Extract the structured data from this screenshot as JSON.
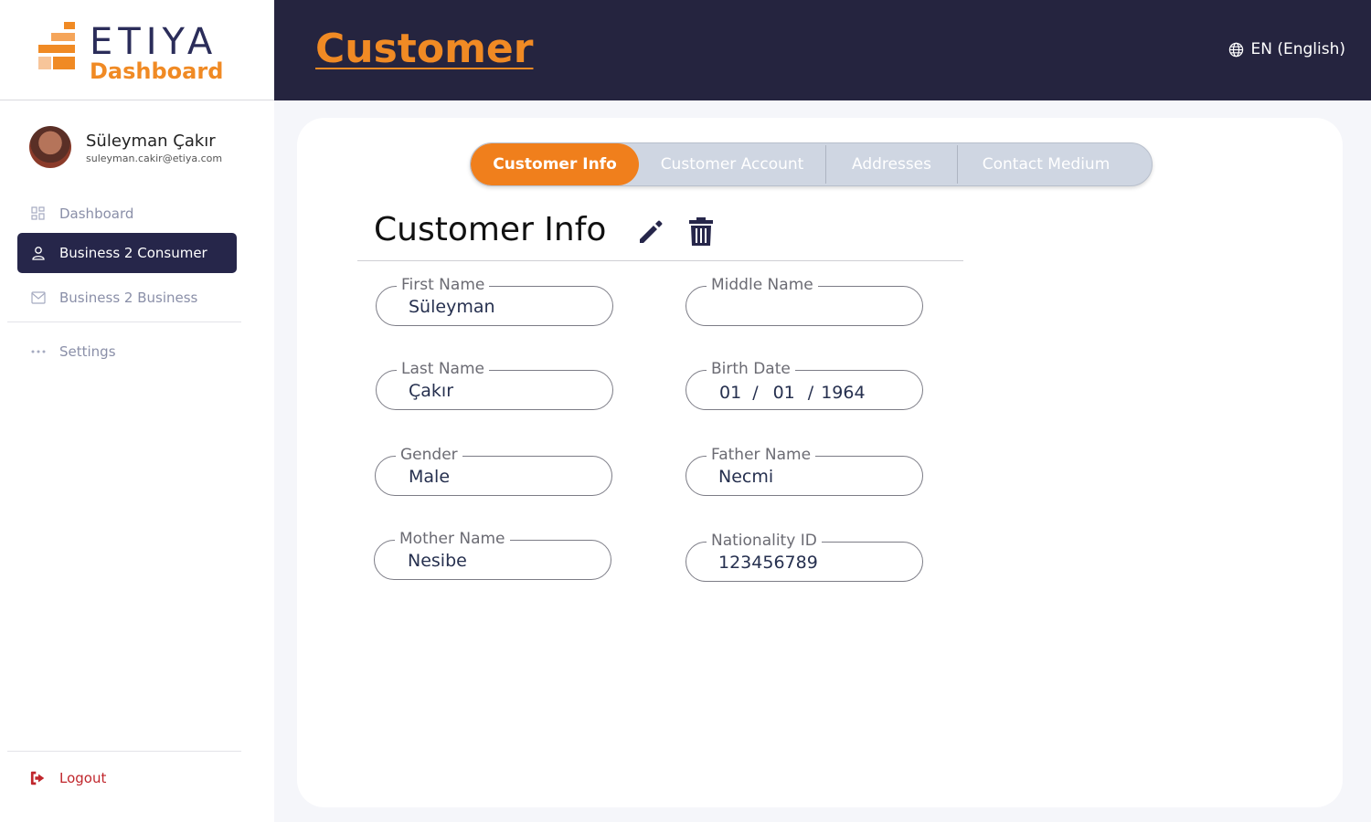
{
  "brand": {
    "name": "ETIYA",
    "subtitle": "Dashboard",
    "accent_color": "#f08a24",
    "dark_color": "#25243f"
  },
  "user": {
    "name": "Süleyman Çakır",
    "email": "suleyman.cakir@etiya.com"
  },
  "sidebar": {
    "items": [
      {
        "label": "Dashboard",
        "icon": "grid-icon",
        "active": false
      },
      {
        "label": "Business 2 Consumer",
        "icon": "user-icon",
        "active": true
      },
      {
        "label": "Business 2 Business",
        "icon": "mail-icon",
        "active": false
      },
      {
        "label": "Settings",
        "icon": "dots-icon",
        "active": false
      }
    ],
    "logout_label": "Logout"
  },
  "header": {
    "title": "Customer",
    "language": "EN (English)"
  },
  "tabs": [
    {
      "label": "Customer Info",
      "active": true
    },
    {
      "label": "Customer Account",
      "active": false
    },
    {
      "label": "Addresses",
      "active": false
    },
    {
      "label": "Contact Medium",
      "active": false
    }
  ],
  "section": {
    "title": "Customer Info",
    "edit_icon": "pencil-icon",
    "delete_icon": "trash-icon"
  },
  "fields": {
    "first_name": {
      "label": "First Name",
      "value": "Süleyman"
    },
    "middle_name": {
      "label": "Middle Name",
      "value": ""
    },
    "last_name": {
      "label": "Last Name",
      "value": "Çakır"
    },
    "birth_date": {
      "label": "Birth Date",
      "day": "01",
      "month": "01",
      "year": "1964",
      "separator": "/"
    },
    "gender": {
      "label": "Gender",
      "value": "Male"
    },
    "father_name": {
      "label": "Father Name",
      "value": "Necmi"
    },
    "mother_name": {
      "label": "Mother Name",
      "value": "Nesibe"
    },
    "nationality_id": {
      "label": "Nationality ID",
      "value": "123456789"
    }
  }
}
